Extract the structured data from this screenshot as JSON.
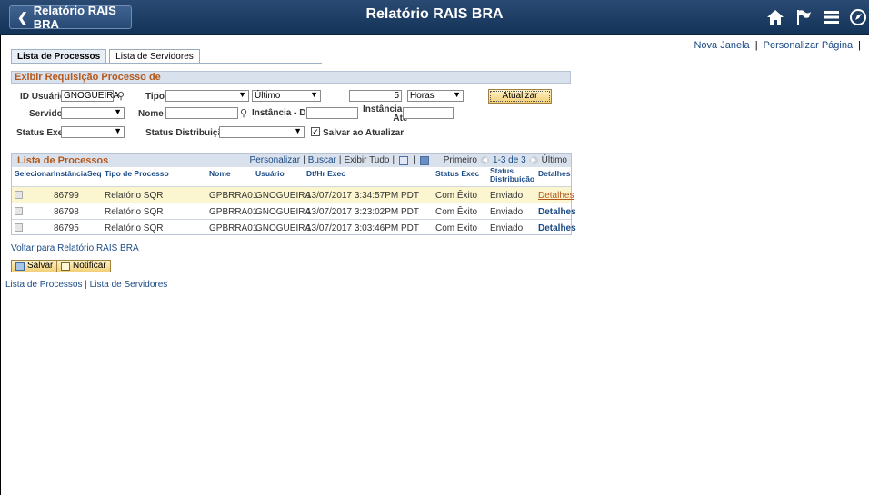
{
  "header": {
    "back_label": "Relatório RAIS BRA",
    "title": "Relatório RAIS BRA",
    "icons": [
      "home-icon",
      "flag-icon",
      "menu-icon",
      "navbar-icon"
    ]
  },
  "toplinks": {
    "new_window": "Nova Janela",
    "personalize_page": "Personalizar Página",
    "sep": "|"
  },
  "tabs": [
    {
      "label": "Lista de Processos",
      "active": true
    },
    {
      "label": "Lista de Servidores",
      "active": false
    }
  ],
  "filter": {
    "section_title": "Exibir Requisição Processo de",
    "user_id_label": "ID Usuário",
    "user_id_value": "GNOGUEIRA",
    "type_label": "Tipo",
    "type_value": "",
    "last_value": "Último",
    "count_value": "5",
    "unit_value": "Horas",
    "refresh_label": "Atualizar",
    "server_label": "Servidor",
    "server_value": "",
    "name_label": "Nome",
    "name_value": "",
    "instance_from_label": "Instância - De",
    "instance_from_value": "",
    "instance_to_label_1": "Instância -",
    "instance_to_label_2": "Até",
    "instance_to_value": "",
    "status_exec_label": "Status Exec",
    "status_exec_value": "",
    "status_dist_label": "Status Distribuição",
    "status_dist_value": "",
    "save_on_refresh_label": "Salvar ao Atualizar",
    "save_on_refresh_checked": "✓"
  },
  "grid": {
    "title": "Lista de Processos",
    "tools": {
      "personalize": "Personalizar",
      "find": "Buscar",
      "view_all": "Exibir Tudo",
      "first": "Primeiro",
      "range": "1-3 de 3",
      "last": "Último"
    },
    "columns": {
      "select": "Selecionar",
      "instance": "Instância",
      "seq": "Seq",
      "process_type": "Tipo de Processo",
      "name": "Nome",
      "user": "Usuário",
      "datetime": "Dt/Hr Exec",
      "status_exec": "Status Exec",
      "status_dist_1": "Status",
      "status_dist_2": "Distribuição",
      "details": "Detalhes"
    },
    "rows": [
      {
        "instance": "86799",
        "seq": "",
        "process_type": "Relatório SQR",
        "name": "GPBRRA01",
        "user": "GNOGUEIRA",
        "datetime": "13/07/2017  3:34:57PM PDT",
        "status_exec": "Com Êxito",
        "status_dist": "Enviado",
        "details": "Detalhes"
      },
      {
        "instance": "86798",
        "seq": "",
        "process_type": "Relatório SQR",
        "name": "GPBRRA01",
        "user": "GNOGUEIRA",
        "datetime": "13/07/2017  3:23:02PM PDT",
        "status_exec": "Com Êxito",
        "status_dist": "Enviado",
        "details": "Detalhes"
      },
      {
        "instance": "86795",
        "seq": "",
        "process_type": "Relatório SQR",
        "name": "GPBRRA01",
        "user": "GNOGUEIRA",
        "datetime": "13/07/2017  3:03:46PM PDT",
        "status_exec": "Com Êxito",
        "status_dist": "Enviado",
        "details": "Detalhes"
      }
    ]
  },
  "footer": {
    "back_link": "Voltar para Relatório RAIS BRA",
    "save_label": "Salvar",
    "notify_label": "Notificar",
    "bottom_link_1": "Lista de Processos",
    "bottom_sep": "|",
    "bottom_link_2": "Lista de Servidores"
  }
}
